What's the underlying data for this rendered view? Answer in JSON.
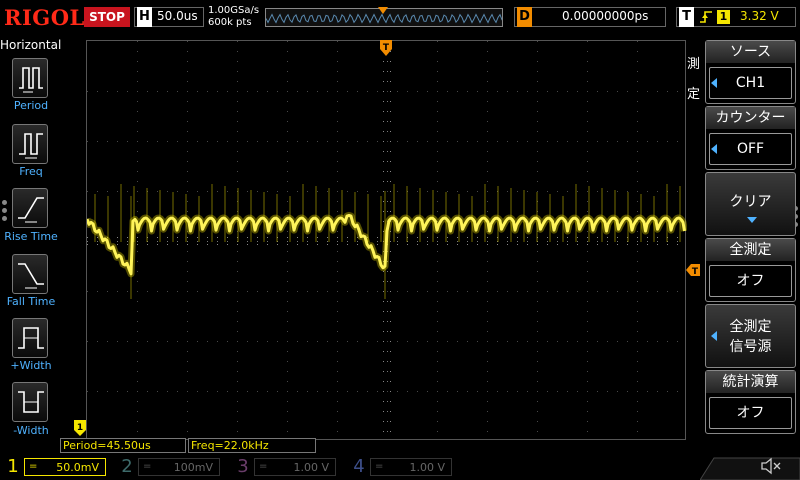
{
  "header": {
    "brand": "RIGOL",
    "run_state": "STOP",
    "timebase_letter": "H",
    "timebase": "50.0us",
    "sample_rate": "1.00GSa/s",
    "memory_depth": "600k pts",
    "trigger_pos_marker": "T",
    "delay_letter": "D",
    "delay": "0.00000000ps",
    "trigger_letter": "T",
    "trigger_source": "1",
    "trigger_level": "3.32 V"
  },
  "left_panel": {
    "title": "Horizontal",
    "items": [
      {
        "label": "Period",
        "icon": "period-icon"
      },
      {
        "label": "Freq",
        "icon": "freq-icon"
      },
      {
        "label": "Rise Time",
        "icon": "rise-time-icon"
      },
      {
        "label": "Fall Time",
        "icon": "fall-time-icon"
      },
      {
        "label": "+Width",
        "icon": "positive-width-icon"
      },
      {
        "label": "-Width",
        "icon": "negative-width-icon"
      }
    ]
  },
  "markers": {
    "trigger_time": "T",
    "trigger_level": "T",
    "ch1_ground": "1"
  },
  "measurements": {
    "period": "Period=45.50us",
    "freq": "Freq=22.0kHz"
  },
  "right_menu": {
    "title_chars": [
      "測",
      "定"
    ],
    "groups": [
      {
        "header": "ソース",
        "value": "CH1"
      },
      {
        "header": "カウンター",
        "value": "OFF"
      },
      {
        "header": "クリア",
        "value": ""
      },
      {
        "header": "全測定",
        "value": "オフ"
      },
      {
        "header": "全測定",
        "value": "信号源"
      },
      {
        "header": "統計演算",
        "value": "オフ"
      }
    ]
  },
  "channels": [
    {
      "num": "1",
      "scale": "50.0mV",
      "color": "#f5e600",
      "active": true
    },
    {
      "num": "2",
      "scale": "100mV",
      "color": "#00c8c8",
      "active": false
    },
    {
      "num": "3",
      "scale": "1.00 V",
      "color": "#e040e0",
      "active": false
    },
    {
      "num": "4",
      "scale": "1.00 V",
      "color": "#3a6cff",
      "active": false
    }
  ],
  "colors": {
    "ch1_trace": "#f5e600",
    "accent_blue": "#4fb2ff",
    "trigger_orange": "#f28c00",
    "stop_red": "#c8141e"
  }
}
